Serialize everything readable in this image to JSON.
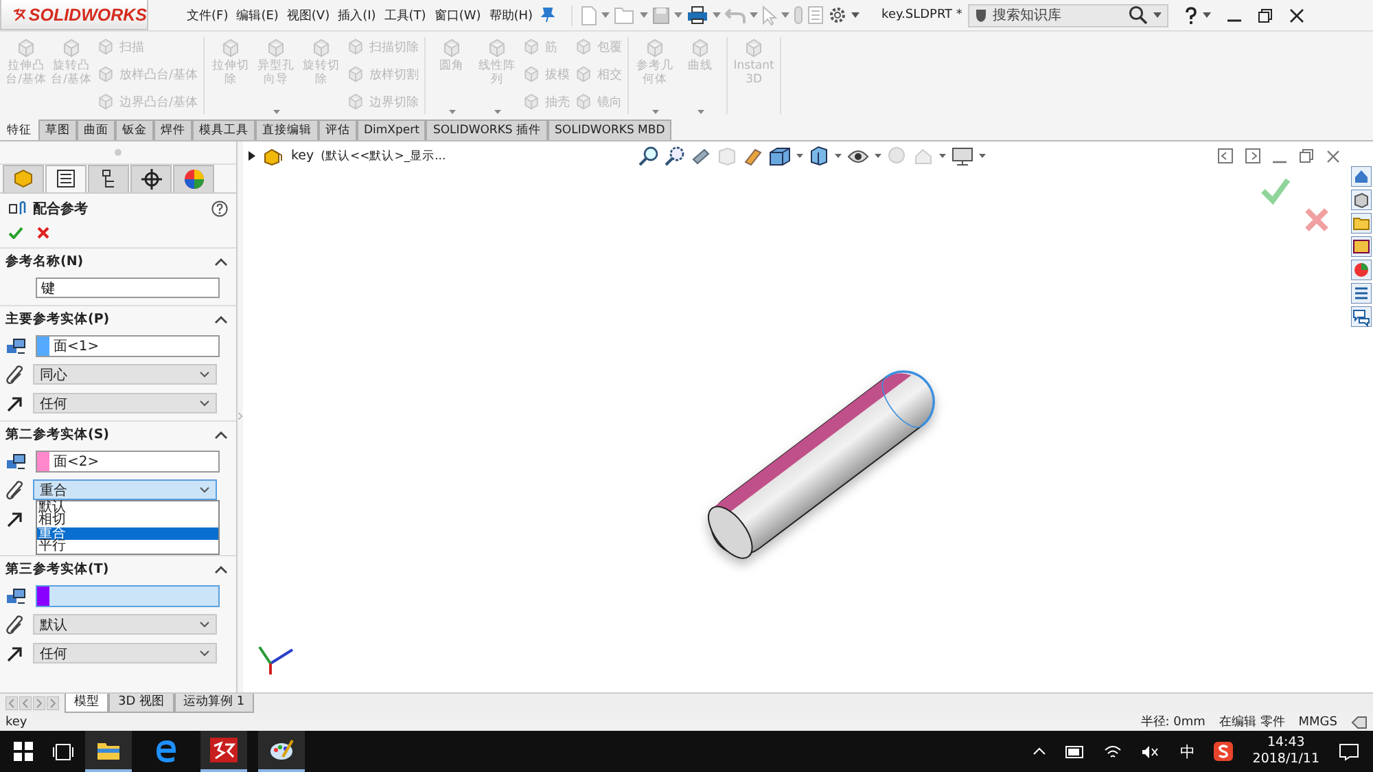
{
  "app": {
    "logo": "SOLIDWORKS",
    "menus": [
      "文件(F)",
      "编辑(E)",
      "视图(V)",
      "插入(I)",
      "工具(T)",
      "窗口(W)",
      "帮助(H)"
    ],
    "document_title": "key.SLDPRT *",
    "search": {
      "placeholder": "搜索知识库"
    }
  },
  "ribbon": [
    {
      "columns": [
        {
          "kind": "large",
          "label": "拉伸凸台/基体",
          "disabled": true
        },
        {
          "kind": "large",
          "label": "旋转凸台/基体",
          "disabled": true
        },
        {
          "kind": "stack",
          "items": [
            {
              "label": "扫描",
              "disabled": true
            },
            {
              "label": "放样凸台/基体",
              "disabled": true
            },
            {
              "label": "边界凸台/基体",
              "disabled": true
            }
          ]
        }
      ]
    },
    {
      "columns": [
        {
          "kind": "large",
          "label": "拉伸切除",
          "disabled": true
        },
        {
          "kind": "large",
          "label": "异型孔向导",
          "disabled": true,
          "dropdown": true
        },
        {
          "kind": "large",
          "label": "旋转切除",
          "disabled": true
        },
        {
          "kind": "stack",
          "items": [
            {
              "label": "扫描切除",
              "disabled": true
            },
            {
              "label": "放样切割",
              "disabled": true
            },
            {
              "label": "边界切除",
              "disabled": true
            }
          ]
        }
      ]
    },
    {
      "columns": [
        {
          "kind": "large",
          "label": "圆角",
          "disabled": true,
          "dropdown": true
        },
        {
          "kind": "large",
          "label": "线性阵列",
          "disabled": true,
          "dropdown": true
        },
        {
          "kind": "stack",
          "items": [
            {
              "label": "筋",
              "disabled": true
            },
            {
              "label": "拔模",
              "disabled": true
            },
            {
              "label": "抽壳",
              "disabled": true
            }
          ]
        },
        {
          "kind": "stack",
          "items": [
            {
              "label": "包覆",
              "disabled": true
            },
            {
              "label": "相交",
              "disabled": true
            },
            {
              "label": "镜向",
              "disabled": true
            }
          ]
        }
      ]
    },
    {
      "columns": [
        {
          "kind": "large",
          "label": "参考几何体",
          "disabled": true,
          "dropdown": true
        },
        {
          "kind": "large",
          "label": "曲线",
          "disabled": true,
          "dropdown": true
        }
      ]
    },
    {
      "columns": [
        {
          "kind": "large",
          "label": "Instant3D",
          "disabled": true
        }
      ]
    }
  ],
  "command_tabs": [
    {
      "label": "特征",
      "selected": true
    },
    {
      "label": "草图",
      "selected": false
    },
    {
      "label": "曲面",
      "selected": false
    },
    {
      "label": "钣金",
      "selected": false
    },
    {
      "label": "焊件",
      "selected": false
    },
    {
      "label": "模具工具",
      "selected": false
    },
    {
      "label": "直接编辑",
      "selected": false
    },
    {
      "label": "评估",
      "selected": false
    },
    {
      "label": "DimXpert",
      "selected": false
    },
    {
      "label": "SOLIDWORKS 插件",
      "selected": false
    },
    {
      "label": "SOLIDWORKS MBD",
      "selected": false
    }
  ],
  "panel_tabs": [
    {
      "kind": "tree",
      "selected": false
    },
    {
      "kind": "property",
      "selected": true
    },
    {
      "kind": "config",
      "selected": false
    },
    {
      "kind": "target",
      "selected": false
    },
    {
      "kind": "display",
      "selected": false
    }
  ],
  "property_manager": {
    "title": "配合参考",
    "sections": [
      {
        "kind": "name",
        "title": "参考名称(N)",
        "expanded": true,
        "value": "键"
      },
      {
        "kind": "entity",
        "title": "主要参考实体(P)",
        "expanded": true,
        "color": "#55aaff",
        "entity": "面<1>",
        "active": false,
        "mate": {
          "value": "同心",
          "open": false
        },
        "alignment": "任何"
      },
      {
        "kind": "entity",
        "title": "第二参考实体(S)",
        "expanded": true,
        "color": "#ff88cc",
        "entity": "面<2>",
        "active": false,
        "mate": {
          "value": "重合",
          "open": true,
          "options": [
            {
              "label": "默认",
              "selected": false
            },
            {
              "label": "相切",
              "selected": false
            },
            {
              "label": "重合",
              "selected": true
            },
            {
              "label": "平行",
              "selected": false
            }
          ]
        }
      },
      {
        "kind": "entity",
        "title": "第三参考实体(T)",
        "expanded": true,
        "color": "#8800ff",
        "active": true,
        "mate": {
          "value": "默认",
          "open": false
        },
        "alignment": "任何"
      }
    ]
  },
  "feature_tree": {
    "name": "key",
    "configuration": "(默认<<默认>_显示..."
  },
  "bottom_tabs": [
    {
      "label": "模型",
      "selected": true
    },
    {
      "label": "3D 视图",
      "selected": false
    },
    {
      "label": "运动算例 1",
      "selected": false
    }
  ],
  "status_bar": {
    "left": "key",
    "radius": "半径: 0mm",
    "mode": "在编辑 零件",
    "units": "MMGS"
  },
  "taskbar": {
    "ime": "中",
    "time": "14:43",
    "date": "2018/1/11"
  }
}
